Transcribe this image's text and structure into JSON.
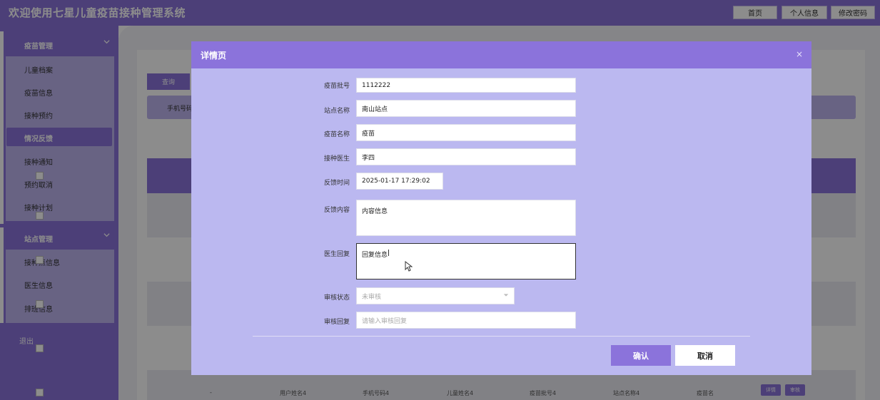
{
  "header": {
    "title": "欢迎使用七星儿童疫苗接种管理系统",
    "buttons": [
      "首页",
      "个人信息",
      "修改密码"
    ]
  },
  "sidebar": {
    "groups": [
      {
        "label": "疫苗管理",
        "items": [
          "儿童档案",
          "疫苗信息",
          "接种预约",
          "情况反馈",
          "接种通知",
          "预约取消",
          "接种计划"
        ]
      },
      {
        "label": "站点管理",
        "items": [
          "接种点信息",
          "医生信息",
          "排班信息"
        ]
      }
    ],
    "active_item": "情况反馈",
    "logout": "退出"
  },
  "background": {
    "query_button": "查询",
    "filter_label": "手机号码",
    "last_row": [
      "-",
      "用户姓名4",
      "手机号码4",
      "儿童姓名4",
      "疫苗批号4",
      "站点名称4",
      "疫苗名"
    ],
    "row_actions": [
      "详情",
      "审核"
    ]
  },
  "dialog": {
    "title": "详情页",
    "close": "×",
    "fields": {
      "batch": {
        "label": "疫苗批号",
        "value": "1112222"
      },
      "site": {
        "label": "站点名称",
        "value": "南山站点"
      },
      "vaccine": {
        "label": "疫苗名称",
        "value": "疫苗"
      },
      "doctor": {
        "label": "接种医生",
        "value": "李四"
      },
      "time": {
        "label": "反馈时间",
        "value": "2025-01-17 17:29:02"
      },
      "content": {
        "label": "反馈内容",
        "value": "内容信息"
      },
      "reply": {
        "label": "医生回复",
        "value": "回复信息"
      },
      "status": {
        "label": "审核状态",
        "placeholder": "未审核"
      },
      "review": {
        "label": "审核回复",
        "placeholder": "请输入审核回复"
      }
    },
    "confirm": "确认",
    "cancel": "取消"
  },
  "colors": {
    "accent": "#8b73db",
    "light_accent": "#bdb4ef",
    "dialog_bg": "#bbb8f0"
  }
}
